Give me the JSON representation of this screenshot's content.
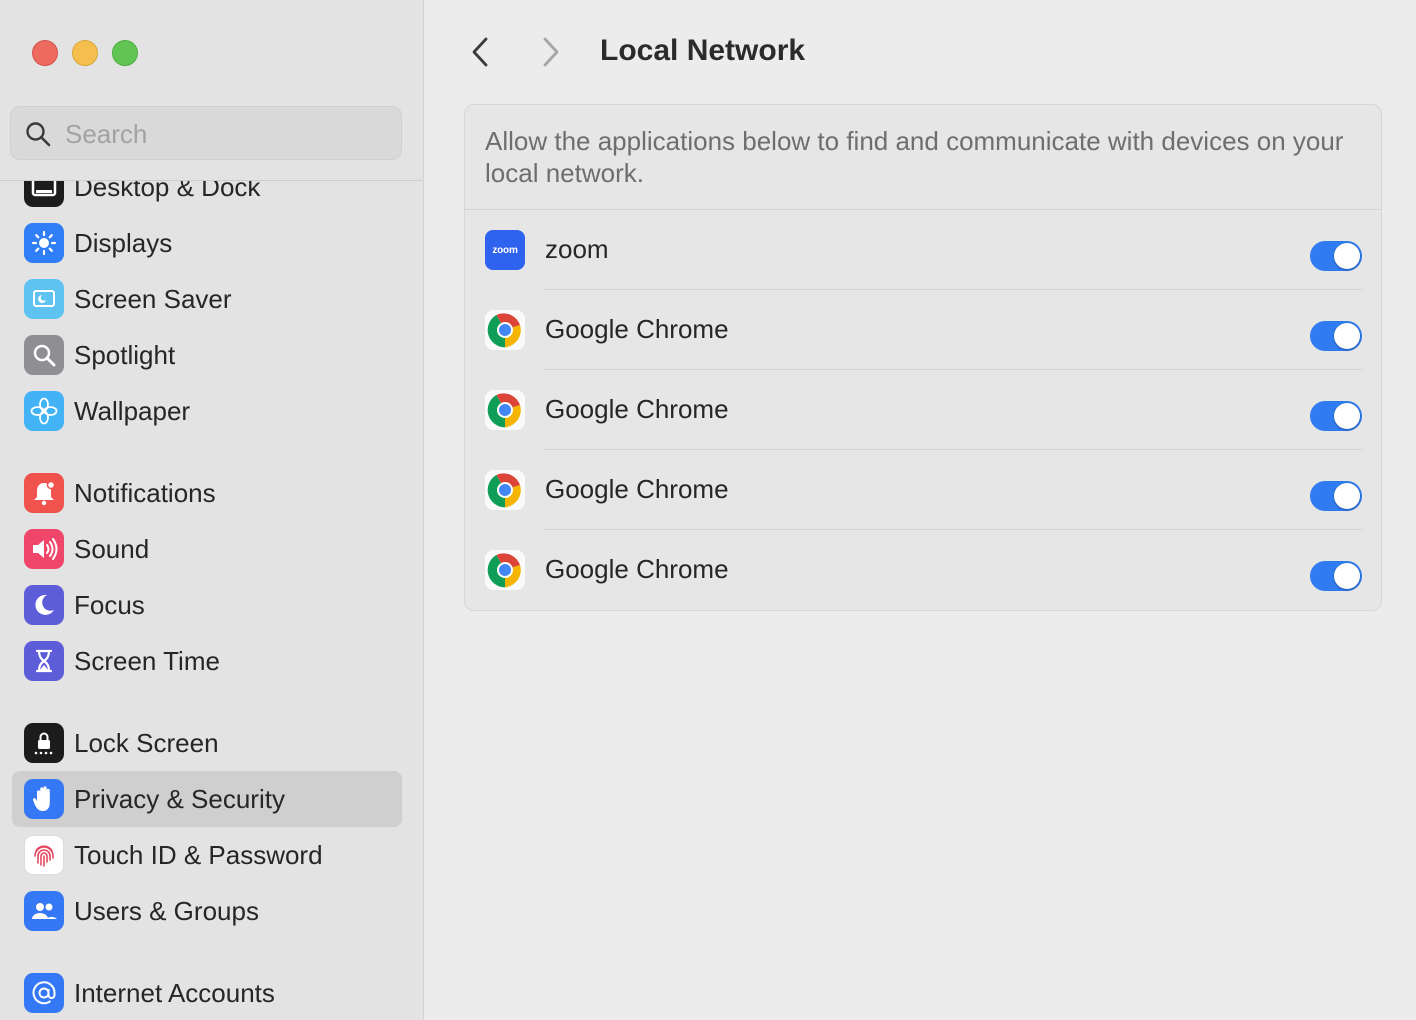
{
  "sidebar": {
    "search_placeholder": "Search",
    "items": [
      {
        "label": "Desktop & Dock",
        "icon": "desktop-dock-icon",
        "color": "#1c1c1c"
      },
      {
        "label": "Displays",
        "icon": "displays-icon",
        "color": "#2f7ef5"
      },
      {
        "label": "Screen Saver",
        "icon": "screen-saver-icon",
        "color": "#5ec3f0"
      },
      {
        "label": "Spotlight",
        "icon": "spotlight-icon",
        "color": "#8e8e93"
      },
      {
        "label": "Wallpaper",
        "icon": "wallpaper-icon",
        "color": "#42b3f5"
      },
      {
        "label": "Notifications",
        "icon": "notifications-icon",
        "color": "#f0524d"
      },
      {
        "label": "Sound",
        "icon": "sound-icon",
        "color": "#f0466a"
      },
      {
        "label": "Focus",
        "icon": "focus-icon",
        "color": "#5d5cd9"
      },
      {
        "label": "Screen Time",
        "icon": "screen-time-icon",
        "color": "#5d5cd9"
      },
      {
        "label": "Lock Screen",
        "icon": "lock-screen-icon",
        "color": "#1c1c1c"
      },
      {
        "label": "Privacy & Security",
        "icon": "privacy-hand-icon",
        "color": "#3478f6",
        "selected": true
      },
      {
        "label": "Touch ID & Password",
        "icon": "fingerprint-icon",
        "color": "#ffffff"
      },
      {
        "label": "Users & Groups",
        "icon": "users-icon",
        "color": "#3478f6"
      },
      {
        "label": "Internet Accounts",
        "icon": "at-sign-icon",
        "color": "#3478f6"
      }
    ]
  },
  "main": {
    "title": "Local Network",
    "description": "Allow the applications below to find and communicate with devices on your local network.",
    "apps": [
      {
        "name": "zoom",
        "icon": "zoom-icon",
        "icon_text": "zoom",
        "enabled": true
      },
      {
        "name": "Google Chrome",
        "icon": "chrome-icon",
        "enabled": true
      },
      {
        "name": "Google Chrome",
        "icon": "chrome-icon",
        "enabled": true
      },
      {
        "name": "Google Chrome",
        "icon": "chrome-icon",
        "enabled": true
      },
      {
        "name": "Google Chrome",
        "icon": "chrome-icon",
        "enabled": true
      }
    ]
  },
  "colors": {
    "accent": "#2f7bef",
    "sidebar_bg": "#e3e3e3",
    "selected_bg": "#cfcfcf"
  }
}
